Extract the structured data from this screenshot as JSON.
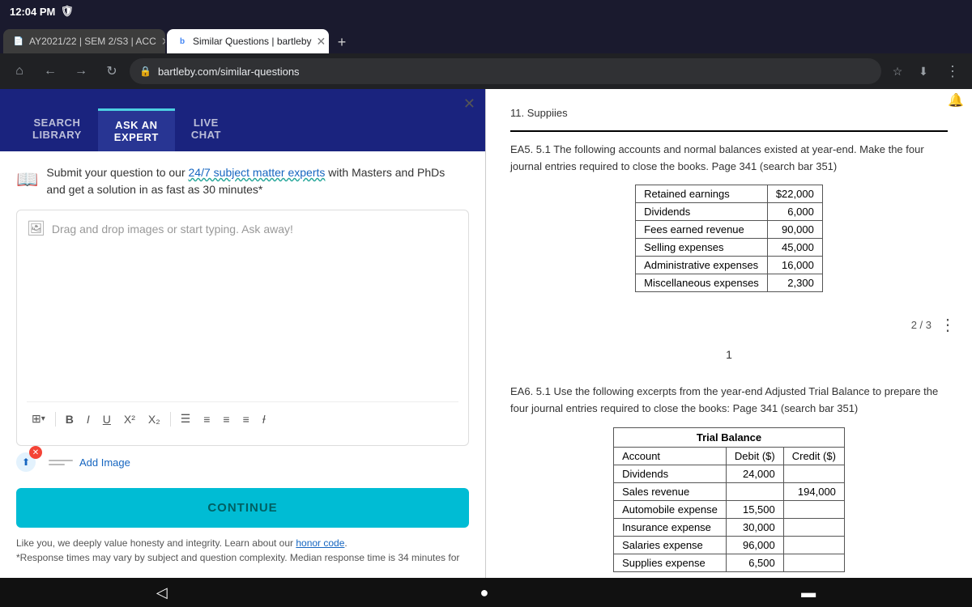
{
  "statusBar": {
    "time": "12:04 PM",
    "shieldIcon": "🛡"
  },
  "tabs": [
    {
      "id": "tab1",
      "favicon": "📄",
      "label": "AY2021/22 | SEM 2/S3 | ACC",
      "active": false
    },
    {
      "id": "tab2",
      "favicon": "b",
      "label": "Similar Questions | bartleby",
      "active": true
    }
  ],
  "tabNew": "+",
  "addressBar": {
    "url": "bartleby.com/similar-questions",
    "backIcon": "←",
    "forwardIcon": "→",
    "reloadIcon": "↻",
    "homeIcon": "⌂",
    "lockIcon": "🔒",
    "bookmarkIcon": "☆",
    "downloadIcon": "⬇",
    "menuIcon": "⋮"
  },
  "closeBtn": "✕",
  "bartleby": {
    "tabs": [
      {
        "label": "SEARCH\nLIBRARY",
        "active": false
      },
      {
        "label": "ASK AN\nEXPERT",
        "active": true
      },
      {
        "label": "LIVE\nCHAT",
        "active": false
      }
    ],
    "banner": {
      "bookIcon": "📖",
      "text1": "Submit your question to our ",
      "linkText": "24/7 subject matter experts",
      "text2": " with Masters and PhDs",
      "text3": "and get a solution in as fast as 30 minutes*"
    },
    "inputPlaceholder": "Drag and drop images or start typing. Ask away!",
    "imageIconLabel": "🖼",
    "toolbar": {
      "tableIcon": "⊞",
      "chevronDown": "▾",
      "boldLabel": "B",
      "italicLabel": "I",
      "underlineLabel": "U",
      "superscriptLabel": "X²",
      "subscriptLabel": "X₂",
      "unorderedListIcon": "☰",
      "orderedListIcon": "≡",
      "alignCenterIcon": "≡",
      "alignRightIcon": "≡",
      "clearFormatIcon": "Ɨ"
    },
    "addImageLabel": "Add Image",
    "continueLabel": "CONTINUE",
    "footerText1": "Like you, we deeply value honesty and integrity. Learn about our ",
    "footerLinkText": "honor code",
    "footerText2": ".",
    "footerText3": "*Response times may vary by subject and question complexity. Median response time is 34 minutes for"
  },
  "document": {
    "topText": "11. Suppiies",
    "bellIcon": "🔔",
    "ea5": {
      "questionLabel": "EA5. 5.1 The following accounts and normal balances existed at year-end. Make the four journal entries required to close the books. Page 341 (search bar 351)",
      "table": {
        "rows": [
          {
            "account": "Retained earnings",
            "amount": "$22,000"
          },
          {
            "account": "Dividends",
            "amount": "6,000"
          },
          {
            "account": "Fees earned revenue",
            "amount": "90,000"
          },
          {
            "account": "Selling expenses",
            "amount": "45,000"
          },
          {
            "account": "Administrative expenses",
            "amount": "16,000"
          },
          {
            "account": "Miscellaneous expenses",
            "amount": "2,300"
          }
        ]
      }
    },
    "pageNum": "2 / 3",
    "moreIcon": "⋮",
    "pageNumCenter": "1",
    "ea6": {
      "questionLabel": "EA6. 5.1 Use the following excerpts from the year-end Adjusted Trial Balance to prepare the four journal entries required to close the books: Page 341 (search bar 351)",
      "table": {
        "header": {
          "col1": "Account",
          "col2": "Debit ($)",
          "col3": "Credit ($)"
        },
        "title": "Trial Balance",
        "rows": [
          {
            "account": "Dividends",
            "debit": "24,000",
            "credit": ""
          },
          {
            "account": "Sales revenue",
            "debit": "",
            "credit": "194,000"
          },
          {
            "account": "Automobile expense",
            "debit": "15,500",
            "credit": ""
          },
          {
            "account": "Insurance expense",
            "debit": "30,000",
            "credit": ""
          },
          {
            "account": "Salaries expense",
            "debit": "96,000",
            "credit": ""
          },
          {
            "account": "Supplies expense",
            "debit": "6,500",
            "credit": ""
          }
        ]
      }
    }
  },
  "navBar": {
    "backIcon": "◁",
    "homeIcon": "●",
    "menuIcon": "▬"
  }
}
